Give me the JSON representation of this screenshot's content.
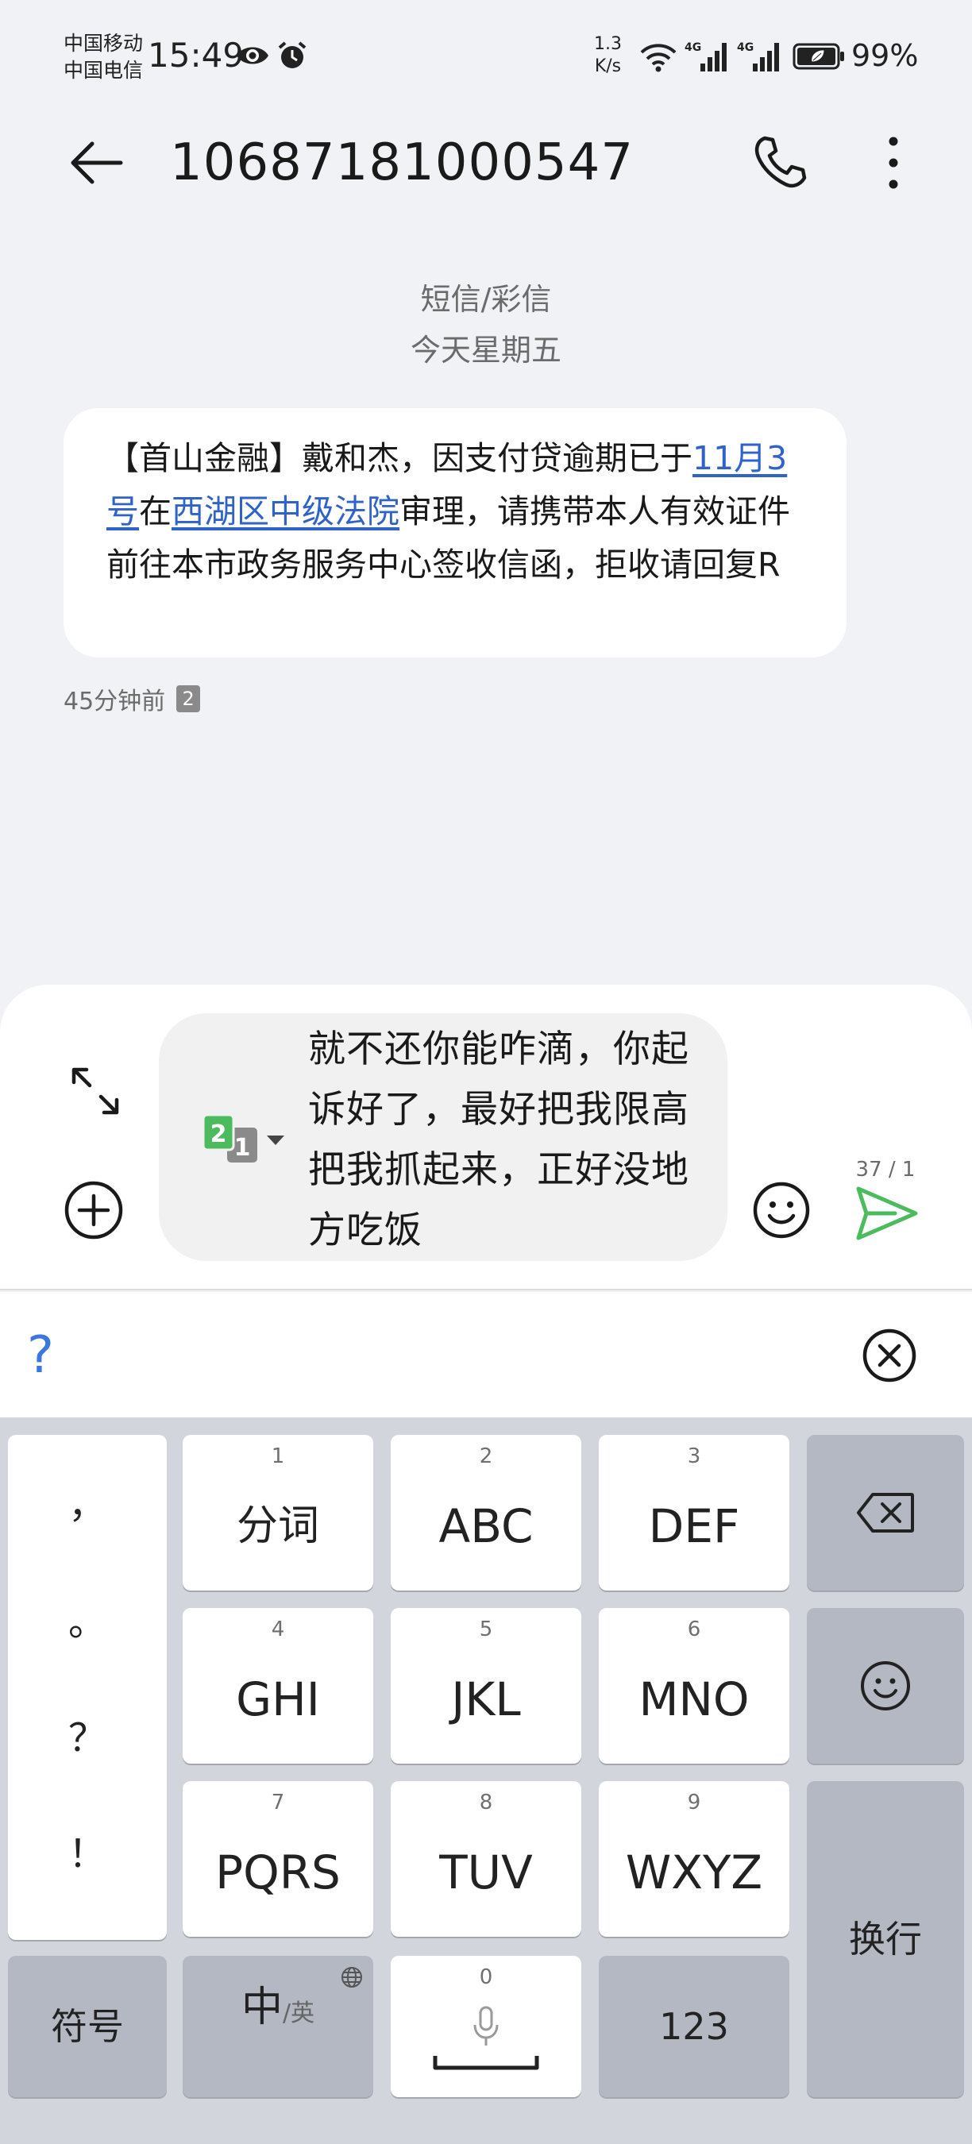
{
  "status_bar": {
    "carrier_1": "中国移动",
    "carrier_2": "中国电信",
    "time": "15:49",
    "net_speed_value": "1.3",
    "net_speed_unit": "K/s",
    "network_1": "4G",
    "network_2": "4G",
    "battery": "99%"
  },
  "header": {
    "contact": "10687181000547"
  },
  "conversation": {
    "message_type": "短信/彩信",
    "date": "今天星期五",
    "message": {
      "part_1": "【首山金融】戴和杰，因支付贷逾期已于",
      "link_date": "11月3号",
      "part_2": "在",
      "link_court": "西湖区中级法院",
      "part_3": "审理，请携带本人有效证件前往本市政务服务中心签收信函，拒收请回复R"
    },
    "time_ago": "45分钟前",
    "sim_badge": "2"
  },
  "compose": {
    "sim_active": "2",
    "sim_other": "1",
    "draft_text": "就不还你能咋滴，你起诉好了，最好把我限高把我抓起来，正好没地方吃饭",
    "char_count": "37 / 1"
  },
  "candidate_bar": {
    "candidate": "?"
  },
  "keyboard": {
    "punct": [
      "，",
      "。",
      "？",
      "！"
    ],
    "keys": [
      {
        "num": "1",
        "label": "分词"
      },
      {
        "num": "2",
        "label": "ABC"
      },
      {
        "num": "3",
        "label": "DEF"
      },
      {
        "num": "4",
        "label": "GHI"
      },
      {
        "num": "5",
        "label": "JKL"
      },
      {
        "num": "6",
        "label": "MNO"
      },
      {
        "num": "7",
        "label": "PQRS"
      },
      {
        "num": "8",
        "label": "TUV"
      },
      {
        "num": "9",
        "label": "WXYZ"
      }
    ],
    "symbols": "符号",
    "lang_main": "中",
    "lang_alt": "/英",
    "space_num": "0",
    "numbers": "123",
    "enter": "换行"
  },
  "colors": {
    "link": "#2f63c8",
    "send": "#4cbb5e",
    "sim_active": "#4cbb5e",
    "candidate": "#3a78e0"
  }
}
